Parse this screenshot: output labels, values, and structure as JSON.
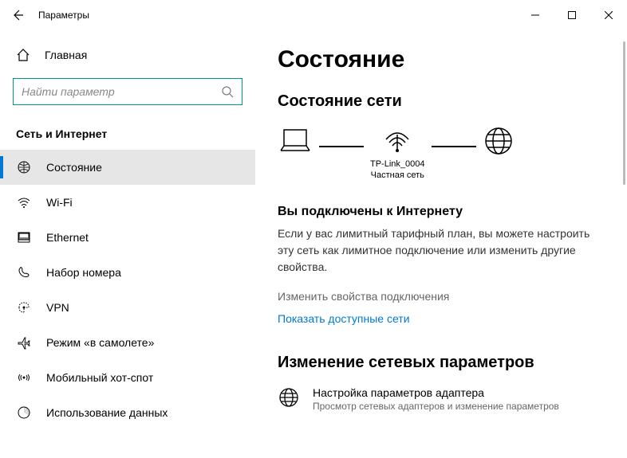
{
  "window": {
    "title": "Параметры"
  },
  "sidebar": {
    "home": "Главная",
    "search_placeholder": "Найти параметр",
    "section": "Сеть и Интернет",
    "items": [
      {
        "label": "Состояние"
      },
      {
        "label": "Wi-Fi"
      },
      {
        "label": "Ethernet"
      },
      {
        "label": "Набор номера"
      },
      {
        "label": "VPN"
      },
      {
        "label": "Режим «в самолете»"
      },
      {
        "label": "Мобильный хот-спот"
      },
      {
        "label": "Использование данных"
      }
    ]
  },
  "main": {
    "heading": "Состояние",
    "sub_heading": "Состояние сети",
    "network_name": "TP-Link_0004",
    "network_type": "Частная сеть",
    "connected_title": "Вы подключены к Интернету",
    "connected_body": "Если у вас лимитный тарифный план, вы можете настроить эту сеть как лимитное подключение или изменить другие свойства.",
    "link_props": "Изменить свойства подключения",
    "link_networks": "Показать доступные сети",
    "change_heading": "Изменение сетевых параметров",
    "adapter_title": "Настройка параметров адаптера",
    "adapter_sub": "Просмотр сетевых адаптеров и изменение параметров"
  }
}
